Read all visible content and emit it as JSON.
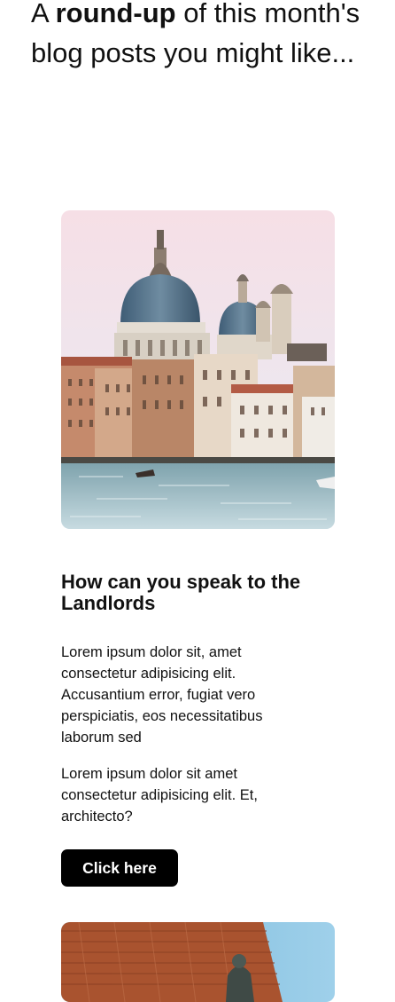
{
  "intro": {
    "prefix": "A ",
    "emphasis": "round-up",
    "suffix": " of this month's blog posts you might like..."
  },
  "post": {
    "title": "How can you speak to the Landlords",
    "paragraph_1": "Lorem ipsum dolor sit, amet consectetur adipisicing elit. Accusantium error, fugiat vero perspiciatis, eos necessitatibus laborum sed",
    "paragraph_2": "Lorem ipsum dolor sit amet consectetur adipisicing elit. Et, architecto?",
    "button_label": "Click here"
  },
  "colors": {
    "button_bg": "#000000",
    "button_text": "#ffffff",
    "text": "#111111"
  }
}
